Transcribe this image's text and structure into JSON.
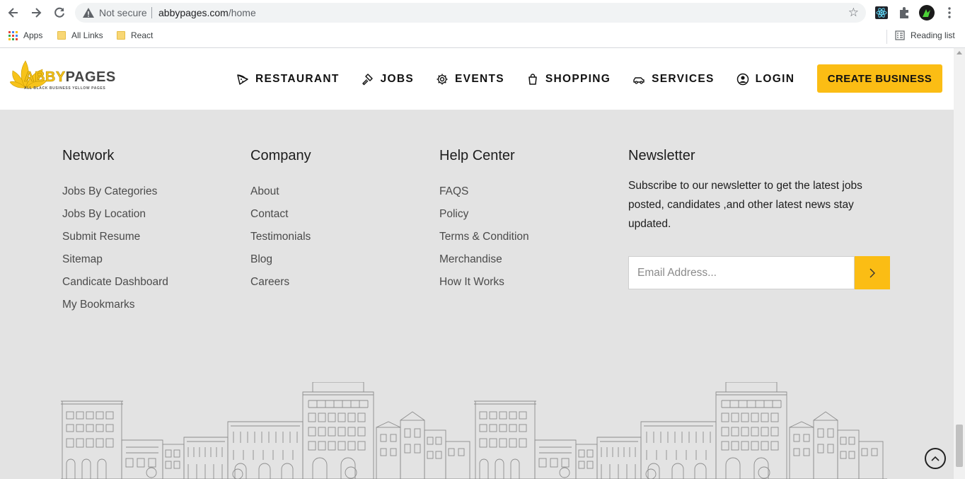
{
  "browser": {
    "security_label": "Not secure",
    "url_domain": "abbypages.com",
    "url_path": "/home",
    "bookmarks": [
      {
        "label": "Apps",
        "icon": "apps-grid-icon"
      },
      {
        "label": "All Links",
        "icon": "folder-icon"
      },
      {
        "label": "React",
        "icon": "folder-icon"
      }
    ],
    "reading_list": "Reading list"
  },
  "header": {
    "logo_abby": "ABBY",
    "logo_pages": "PAGES",
    "logo_tagline": "ALL BLACK BUSINESS YELLOW PAGES",
    "nav": [
      {
        "label": "RESTAURANT",
        "icon": "pizza-slice-icon"
      },
      {
        "label": "JOBS",
        "icon": "hammer-icon"
      },
      {
        "label": "EVENTS",
        "icon": "gear-icon"
      },
      {
        "label": "SHOPPING",
        "icon": "shopping-bag-icon"
      },
      {
        "label": "SERVICES",
        "icon": "car-icon"
      },
      {
        "label": "LOGIN",
        "icon": "user-circle-icon"
      }
    ],
    "cta_label": "CREATE BUSINESS"
  },
  "footer": {
    "network": {
      "title": "Network",
      "links": [
        "Jobs By Categories",
        "Jobs By Location",
        "Submit Resume",
        "Sitemap",
        "Candicate Dashboard",
        "My Bookmarks"
      ]
    },
    "company": {
      "title": "Company",
      "links": [
        "About",
        "Contact",
        "Testimonials",
        "Blog",
        "Careers"
      ]
    },
    "help": {
      "title": "Help Center",
      "links": [
        "FAQS",
        "Policy",
        "Terms & Condition",
        "Merchandise",
        "How It Works"
      ]
    },
    "newsletter": {
      "title": "Newsletter",
      "description": "Subscribe to our newsletter to get the latest jobs posted, candidates ,and other latest news stay updated.",
      "email_placeholder": "Email Address..."
    }
  },
  "colors": {
    "accent": "#fbbd14",
    "footer_bg": "#e3e3e3",
    "text_dark": "#1d1d1d",
    "text_link": "#4b4b4b"
  }
}
